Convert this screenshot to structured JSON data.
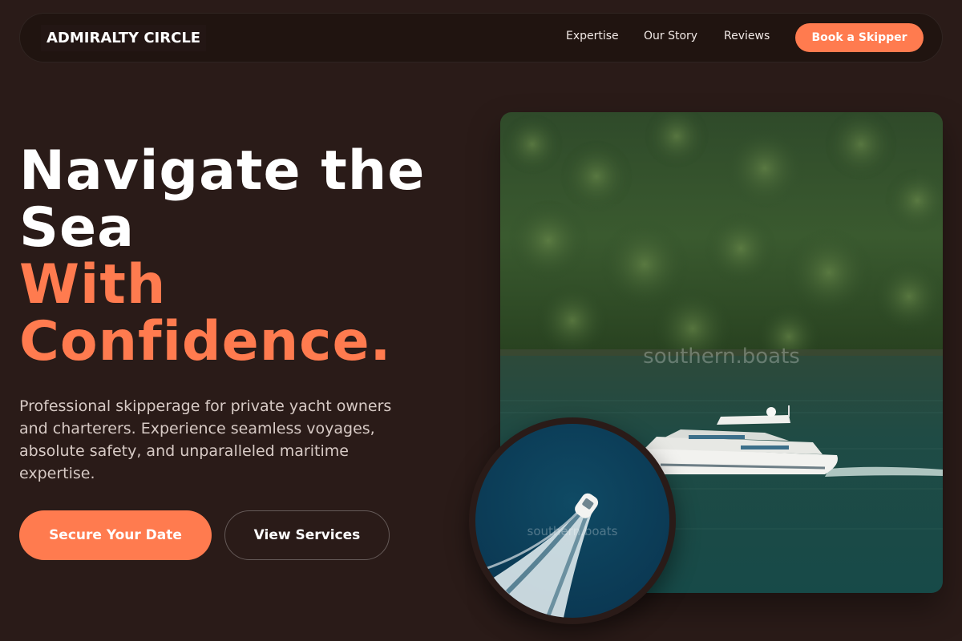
{
  "brand": {
    "name": "ADMIRALTY CIRCLE"
  },
  "nav": {
    "links": [
      "Expertise",
      "Our Story",
      "Reviews"
    ],
    "cta_label": "Book a Skipper"
  },
  "hero": {
    "headline_line1": "Navigate the",
    "headline_line2": "Sea",
    "headline_accent_line1": "With",
    "headline_accent_line2": "Confidence.",
    "description": "Professional skipperage for private yacht owners and charterers. Experience seamless voyages, absolute safety, and unparalleled maritime expertise.",
    "primary_cta": "Secure Your Date",
    "secondary_cta": "View Services"
  },
  "media": {
    "main_image_watermark": "southern.boats",
    "circle_image_watermark": "southern.boats",
    "main_image_subject": "white motor yacht cruising past forested hillside",
    "circle_image_subject": "aerial view of speedboat wake on deep blue water"
  },
  "colors": {
    "background": "#2a1b18",
    "accent": "#ff7b4f",
    "text_primary": "#ffffff",
    "text_muted": "#d7cac5"
  }
}
